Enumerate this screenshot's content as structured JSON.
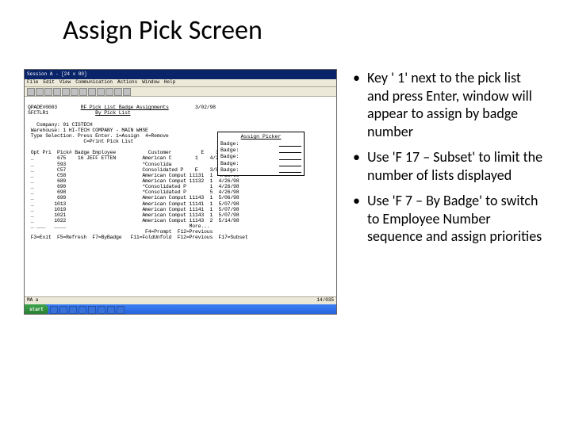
{
  "title": "Assign Pick Screen",
  "bullets": [
    "Key ' 1' next to the pick list and press Enter, window will appear to assign by badge number",
    "Use 'F 17 – Subset' to limit the number of lists displayed",
    "Use 'F 7 – By Badge' to switch to Employee Number sequence and assign priorities"
  ],
  "screenshot": {
    "window_title": "Session A - [24 x 80]",
    "menus": [
      "File",
      "Edit",
      "View",
      "Communication",
      "Actions",
      "Window",
      "Help"
    ],
    "term": {
      "program": "QPADEV0003",
      "screen_id": "RF Pick List Badge Assignments",
      "date": "3/02/98",
      "subprogram": "SFCTLR1",
      "sort": "By Pick List",
      "company_line": "Company: 01 CISTECH",
      "warehouse_line": "Warehouse: 1 HI-TECH COMPANY - MAIN WHSE",
      "type_line": "Type Selection. Press Enter. 1=Assign  4=Remove",
      "c_line": "C=Print Pick List",
      "columns": "Opt Pri  Pick# Badge Employee           Customer          E    3/02/97",
      "rows": [
        " _        675    16 JEFF ETTEN         American C        1    4/26/98",
        " _        593                          *Consolida",
        " _        C57                          Consolidated P    E    3/02/97",
        " _        C58                          American Comput 11131  1  4/26/98",
        " _        689                          American Comput 11132  1  4/26/98",
        " _        690                          *Consolidated P        1  4/26/98",
        " _        698                          *Consolidated P        5  4/26/98",
        " _        699                          American Comput 11143  1  5/06/98",
        " _       1013                          American Comput 11141  1  5/07/98",
        " _       1019                          American Comput 11141  1  5/07/98",
        " _       1021                          American Comput 11143  1  5/07/98",
        " _       1022                          American Comput 11143  2  5/14/98",
        " _ ___   ____                                          More..."
      ],
      "fkey_line_1": "F4=Prompt  F12=Previous",
      "fkey_line_2": "F3=Exit  F5=Refresh  F7=ByBadge   F11=FoldUnfold  F12=Previous  F17=Subset"
    },
    "popup": {
      "title": "Assign Picker",
      "lines": [
        "Badge:",
        "Badge:",
        "Badge:",
        "Badge:",
        "Badge:"
      ]
    },
    "status_left": "MA   a",
    "status_right": "14/035",
    "taskbar": {
      "start": "start",
      "tasks": [
        "",
        "",
        "",
        "",
        "",
        "",
        "",
        ""
      ]
    }
  }
}
